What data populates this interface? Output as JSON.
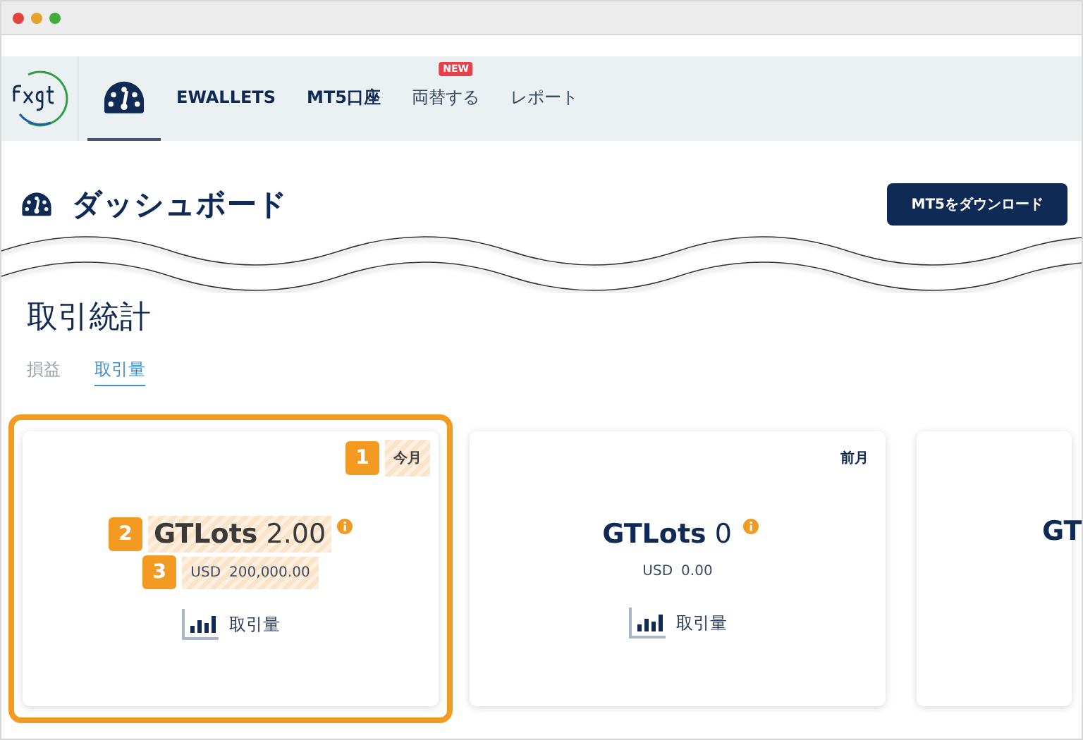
{
  "nav": {
    "items": [
      {
        "kind": "icon",
        "selected": true
      },
      {
        "kind": "strong",
        "label": "EWALLETS",
        "selected": false
      },
      {
        "kind": "strong",
        "label": "MT5口座",
        "selected": false
      },
      {
        "kind": "plain",
        "label": "両替する",
        "badge": "NEW",
        "selected": false
      },
      {
        "kind": "plain",
        "label": "レポート",
        "selected": false
      }
    ]
  },
  "header": {
    "title": "ダッシュボード",
    "button": "MT5をダウンロード"
  },
  "stats": {
    "title": "取引統計",
    "tabs": [
      {
        "label": "損益",
        "selected": false
      },
      {
        "label": "取引量",
        "selected": true
      }
    ]
  },
  "cards": [
    {
      "highlighted": true,
      "period": "今月",
      "period_marker": "1",
      "lots_label": "GTLots",
      "lots_value": "2.00",
      "lots_marker": "2",
      "usd_label": "USD",
      "usd_value": "200,000.00",
      "usd_marker": "3",
      "link": "取引量"
    },
    {
      "highlighted": false,
      "period": "前月",
      "lots_label": "GTLots",
      "lots_value": "0",
      "usd_label": "USD",
      "usd_value": "0.00",
      "link": "取引量"
    },
    {
      "highlighted": false,
      "lots_label": "GT"
    }
  ]
}
